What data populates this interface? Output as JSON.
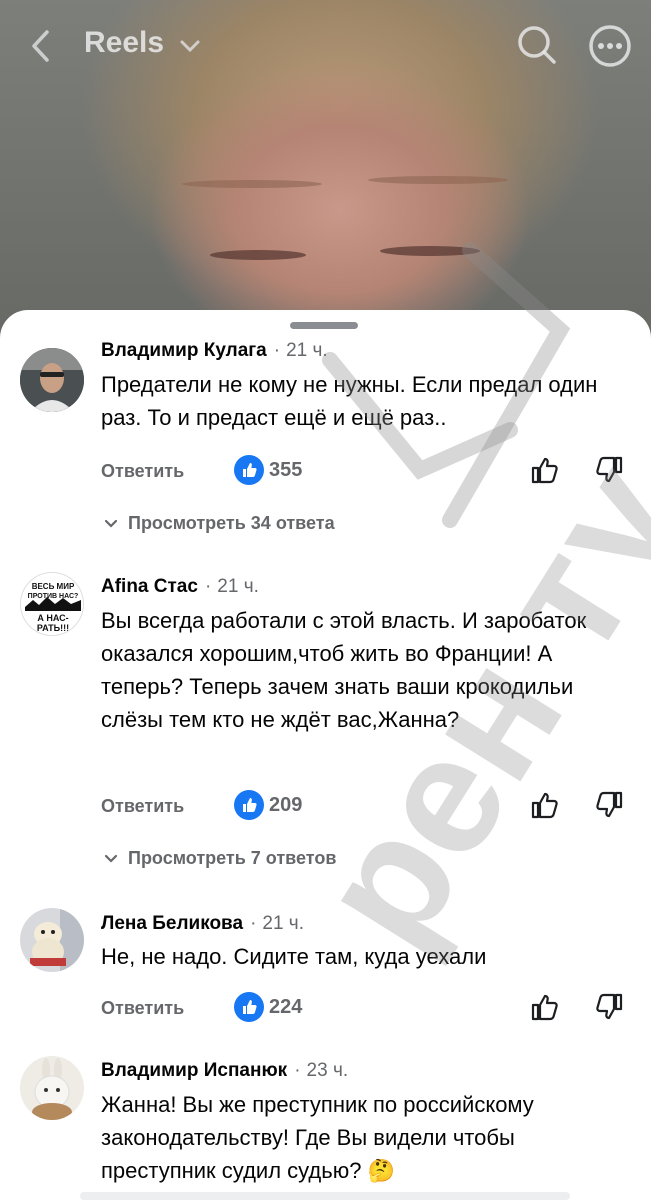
{
  "header": {
    "title": "Reels",
    "icons": {
      "back": "back-chevron-icon",
      "dropdown": "chevron-down-icon",
      "search": "search-icon",
      "more": "more-icon"
    }
  },
  "comments": [
    {
      "author": "Владимир Кулага",
      "time": "21 ч.",
      "text": "Предатели не кому не нужны. Если предал один раз. То и предаст ещё и ещё раз..",
      "reply_label": "Ответить",
      "likes": "355",
      "view_replies": "Просмотреть 34 ответа"
    },
    {
      "author": "Afina Стас",
      "time": "21 ч.",
      "text": "Вы всегда работали с этой власть. И заробаток оказался хорошим,чтоб жить во Франции! А теперь? Теперь зачем знать ваши крокодильи слёзы тем кто не ждёт вас,Жанна?",
      "reply_label": "Ответить",
      "likes": "209",
      "view_replies": "Просмотреть 7 ответов",
      "avatar_text": [
        "ВЕСЬ МИР",
        "ПРОТИВ НАС?",
        "А НАС-",
        "РАТЬ!!!"
      ]
    },
    {
      "author": "Лена Беликова",
      "time": "21 ч.",
      "text": "Не, не надо. Сидите там, куда уехали",
      "reply_label": "Ответить",
      "likes": "224"
    },
    {
      "author": "Владимир Испанюк",
      "time": "23 ч.",
      "text": "Жанна! Вы же преступник по российскому законодательству! Где Вы видели чтобы преступник судил судью?",
      "emoji": "🤔"
    }
  ],
  "watermark": "рен ту",
  "colors": {
    "like_blue": "#1877f2",
    "meta_gray": "#65676b",
    "text": "#050505"
  }
}
